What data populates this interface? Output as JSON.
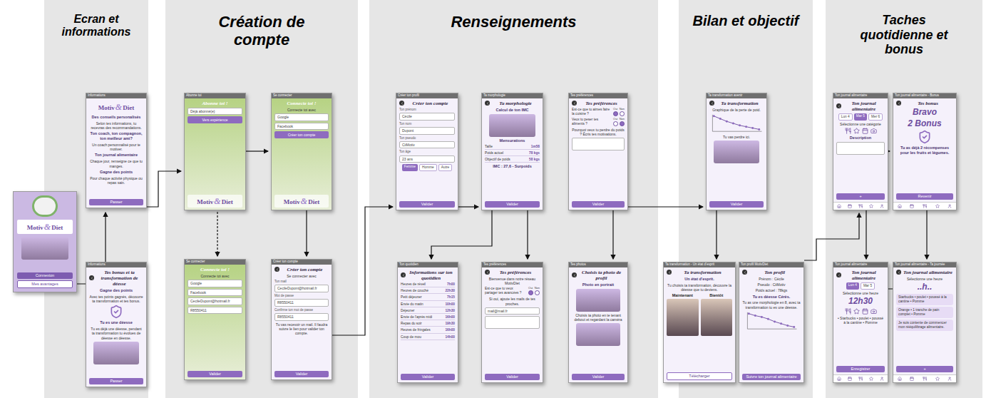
{
  "sections": [
    {
      "title": "Ecran et informations"
    },
    {
      "title": "Création de compte"
    },
    {
      "title": "Renseignements"
    },
    {
      "title": "Bilan et objectif"
    },
    {
      "title": "Taches quotidienne et bonus"
    }
  ],
  "screens": [
    {
      "kind": "splash",
      "logo": {
        "first": "Motiv",
        "amp": "&",
        "second": "Diet"
      },
      "items": [
        {
          "kind": "photo"
        }
      ],
      "buttons": [
        {
          "label": "Connexion",
          "kind": "primary"
        },
        {
          "label": "Mes avantages",
          "kind": "outline"
        }
      ]
    },
    {
      "kind": "app",
      "bar": "Informations",
      "logo": {
        "first": "Motiv",
        "amp": "&",
        "second": "Diet"
      },
      "items": [
        {
          "kind": "title",
          "text": "Des conseils personalisés"
        },
        {
          "kind": "text",
          "text": "Selon tes informations, tu recevras des recommandations."
        },
        {
          "kind": "title",
          "text": "Ton coach, ton compagnon, ton meilleur ami?"
        },
        {
          "kind": "text",
          "text": "Un coach personnalisé pour te motiver."
        },
        {
          "kind": "title",
          "text": "Ton journal alimentaire"
        },
        {
          "kind": "text",
          "text": "Chaque jour, renseigne ce que tu manges."
        },
        {
          "kind": "title",
          "text": "Gagne des points"
        },
        {
          "kind": "text",
          "text": "Pour chaque activité physique ou repas sain."
        }
      ],
      "buttons": [
        {
          "label": "Passer",
          "kind": "primary"
        }
      ]
    },
    {
      "kind": "app",
      "bar": "Informations",
      "heading": "Tes bonus et ta transformation de déesse",
      "items": [
        {
          "kind": "title",
          "text": "Gagne des points"
        },
        {
          "kind": "text",
          "text": "Avec tes points gagnés, découvre ta transformation et tes bonus."
        },
        {
          "kind": "badge"
        },
        {
          "kind": "title",
          "text": "Tu es une déesse"
        },
        {
          "kind": "text",
          "text": "Tu es déjà une déesse, pendant ta transformation tu évolues de déesse en déesse."
        },
        {
          "kind": "photo"
        }
      ],
      "buttons": [
        {
          "label": "Passer",
          "kind": "primary"
        }
      ]
    },
    {
      "kind": "photo",
      "bar": "Abonne toi",
      "heading": "Abonne toi !",
      "logo": {
        "first": "Motiv",
        "amp": "&",
        "second": "Diet"
      },
      "items": [
        {
          "kind": "field",
          "text": "Déjà abonné(e)"
        },
        {
          "kind": "button",
          "text": "Vers expérience"
        }
      ],
      "buttons": []
    },
    {
      "kind": "photo",
      "bar": "Se connecter",
      "heading": "Connecte toi !",
      "logo": {
        "first": "Motiv",
        "amp": "&",
        "second": "Diet"
      },
      "items": [
        {
          "kind": "text",
          "text": "Connecte toi avec"
        },
        {
          "kind": "field",
          "text": "Google"
        },
        {
          "kind": "field",
          "text": "Facebook"
        },
        {
          "kind": "button",
          "text": "Créer ton compte"
        }
      ],
      "buttons": []
    },
    {
      "kind": "photo",
      "bar": "Se connecter",
      "heading": "Connecte toi !",
      "items": [
        {
          "kind": "text",
          "text": "Connecte toi avec"
        },
        {
          "kind": "field",
          "text": "Google"
        },
        {
          "kind": "field",
          "text": "Facebook"
        },
        {
          "kind": "field",
          "text": "CecileDupont@hotmail.fr"
        },
        {
          "kind": "field",
          "text": "R8550411"
        }
      ],
      "buttons": [
        {
          "label": "Valider",
          "kind": "primary"
        }
      ]
    },
    {
      "kind": "app",
      "bar": "Créer ton compte",
      "heading": "Créer ton compte",
      "items": [
        {
          "kind": "text",
          "text": "Se connecter avec"
        },
        {
          "kind": "label",
          "text": "Ton mail"
        },
        {
          "kind": "field",
          "text": "CecileDupont@hotmail.fr"
        },
        {
          "kind": "label",
          "text": "Mot de passe"
        },
        {
          "kind": "field",
          "text": "R8550411"
        },
        {
          "kind": "label",
          "text": "Confirme ton mot de passe"
        },
        {
          "kind": "field",
          "text": "R8550411"
        },
        {
          "kind": "text",
          "text": "Tu vas recevoir un mail. Il faudra suivre le lien pour valider ton compte."
        }
      ],
      "buttons": [
        {
          "label": "Valider",
          "kind": "primary"
        }
      ]
    },
    {
      "kind": "app",
      "bar": "Créer ton profil",
      "heading": "Créer ton compte",
      "items": [
        {
          "kind": "label",
          "text": "Ton prénom"
        },
        {
          "kind": "field",
          "text": "Cécile"
        },
        {
          "kind": "label",
          "text": "Ton nom"
        },
        {
          "kind": "field",
          "text": "Dupont"
        },
        {
          "kind": "label",
          "text": "Ton pseudo"
        },
        {
          "kind": "field",
          "text": "CiiMotiv"
        },
        {
          "kind": "label",
          "text": "Ton âge"
        },
        {
          "kind": "field",
          "text": "23 ans"
        },
        {
          "kind": "pills",
          "options": [
            {
              "label": "Femme",
              "selected": true
            },
            {
              "label": "Homme",
              "selected": false
            },
            {
              "label": "Autre",
              "selected": false
            }
          ]
        }
      ],
      "buttons": [
        {
          "label": "Valider",
          "kind": "primary"
        }
      ]
    },
    {
      "kind": "app",
      "bar": "Ta morphologie",
      "heading": "Ta morphologie",
      "items": [
        {
          "kind": "title",
          "text": "Calcul de ton IMC"
        },
        {
          "kind": "photo"
        },
        {
          "kind": "title",
          "text": "Mensurations"
        },
        {
          "kind": "row",
          "label": "Taille",
          "value": "1m58"
        },
        {
          "kind": "row",
          "label": "Poids actuel",
          "value": "78 kgs"
        },
        {
          "kind": "row",
          "label": "Objectif de poids",
          "value": "58 kgs"
        },
        {
          "kind": "title",
          "text": "IMC : 27,6 - Surpoids"
        }
      ],
      "buttons": [
        {
          "label": "Valider",
          "kind": "primary"
        }
      ]
    },
    {
      "kind": "app",
      "bar": "Tes préférences",
      "heading": "Tes préférences",
      "items": [
        {
          "kind": "yesno",
          "text": "Est-ce que tu aimes faire la cuisine ?",
          "options": [
            {
              "label": "Oui",
              "selected": true
            },
            {
              "label": "Non",
              "selected": false
            }
          ]
        },
        {
          "kind": "yesno",
          "text": "Veux tu peser tes aliments ?",
          "options": [
            {
              "label": "Oui",
              "selected": false
            },
            {
              "label": "Non",
              "selected": true
            }
          ]
        },
        {
          "kind": "text",
          "text": "Pourquoi veux tu perdre du poids ? Écris tes motivations."
        },
        {
          "kind": "area"
        }
      ],
      "buttons": [
        {
          "label": "Valider",
          "kind": "primary"
        }
      ]
    },
    {
      "kind": "app",
      "bar": "Ton quotidien",
      "heading": "Informations sur ton quotidien",
      "items": [
        {
          "kind": "row",
          "label": "Heures de réveil",
          "value": "7h00"
        },
        {
          "kind": "row",
          "label": "Heures de couché",
          "value": "22h30"
        },
        {
          "kind": "row",
          "label": "Petit déjeuner",
          "value": "7h15"
        },
        {
          "kind": "row",
          "label": "Envie du matin",
          "value": "10h00"
        },
        {
          "kind": "row",
          "label": "Déjeuner",
          "value": "12h30"
        },
        {
          "kind": "row",
          "label": "Envie de l'après midi",
          "value": "16h00"
        },
        {
          "kind": "row",
          "label": "Repas du soir",
          "value": "19h30"
        },
        {
          "kind": "row",
          "label": "Heures de fringales",
          "value": "16h00"
        },
        {
          "kind": "row",
          "label": "Coup de mou",
          "value": "14h00"
        }
      ],
      "buttons": [
        {
          "label": "Valider",
          "kind": "primary"
        }
      ]
    },
    {
      "kind": "app",
      "bar": "Tes préférences",
      "heading": "Tes préférences",
      "items": [
        {
          "kind": "text",
          "text": "Bienvenue dans notre réseau MotivDiet"
        },
        {
          "kind": "yesno",
          "text": "Est-ce que tu veux partager tes avancées ?",
          "options": [
            {
              "label": "Oui",
              "selected": true
            },
            {
              "label": "Non",
              "selected": false
            }
          ]
        },
        {
          "kind": "text",
          "text": "Si oui, ajoute les mails de tes proches."
        },
        {
          "kind": "field",
          "text": "mail@mail.fr"
        },
        {
          "kind": "area"
        }
      ],
      "buttons": [
        {
          "label": "Valider",
          "kind": "primary"
        }
      ]
    },
    {
      "kind": "app",
      "bar": "Tes photos",
      "heading": "Choisis ta photo de profil",
      "items": [
        {
          "kind": "title",
          "text": "Photo en portrait"
        },
        {
          "kind": "photo"
        },
        {
          "kind": "text",
          "text": "Choisis ta photo en te tenant debout et regardant la caméra"
        },
        {
          "kind": "photo"
        }
      ],
      "buttons": [
        {
          "label": "Valider",
          "kind": "primary"
        }
      ]
    },
    {
      "kind": "app",
      "bar": "Ta transformation avenir",
      "heading": "Ta transformation",
      "items": [
        {
          "kind": "text",
          "text": "Graphique de la perte de poid."
        },
        {
          "kind": "chart",
          "values": [
            78,
            74,
            70,
            67,
            64,
            62,
            60,
            58
          ]
        },
        {
          "kind": "text",
          "text": "Tu vas perdre ici."
        },
        {
          "kind": "photo"
        }
      ],
      "buttons": [
        {
          "label": "Valider",
          "kind": "primary"
        }
      ]
    },
    {
      "kind": "app",
      "bar": "Ta transformation - Un état d'esprit",
      "heading": "Ta transformation",
      "items": [
        {
          "kind": "title",
          "text": "Un état d'esprit."
        },
        {
          "kind": "text",
          "text": "Tu choisis ta transformation, découvre la déesse que tu deviens."
        },
        {
          "kind": "compare",
          "labels": [
            "Maintenant",
            "Bientôt"
          ]
        }
      ],
      "buttons": [
        {
          "label": "Télécharger",
          "kind": "outline"
        }
      ]
    },
    {
      "kind": "app",
      "bar": "Ton profil MotivDiet",
      "heading": "Ton profil",
      "items": [
        {
          "kind": "text",
          "text": "Prénom : Cécile"
        },
        {
          "kind": "text",
          "text": "Pseudo : CiiMotiv"
        },
        {
          "kind": "text",
          "text": "Poids actuel : 78kgs"
        },
        {
          "kind": "title",
          "text": "Tu es déesse Cérès."
        },
        {
          "kind": "text",
          "text": "Tu as une morphologie en 8, avec ta transformation tu es une déesse."
        },
        {
          "kind": "chart",
          "values": [
            78,
            75,
            73,
            70,
            66,
            63,
            60,
            58
          ]
        }
      ],
      "buttons": [
        {
          "label": "Suivre ton journal alimentaire",
          "kind": "primary"
        }
      ]
    },
    {
      "kind": "app",
      "bar": "Ton journal alimentaire",
      "heading": "Ton journal alimentaire",
      "nav": true,
      "items": [
        {
          "kind": "chips",
          "options": [
            {
              "label": "Lun 4",
              "selected": false
            },
            {
              "label": "Mar 5",
              "selected": true
            },
            {
              "label": "Mer 6",
              "selected": false
            }
          ]
        },
        {
          "kind": "text",
          "text": "Sélectionne une catégorie"
        },
        {
          "kind": "meals"
        },
        {
          "kind": "title",
          "text": "Description"
        },
        {
          "kind": "area"
        }
      ],
      "buttons": [
        {
          "label": "+",
          "kind": "primary"
        }
      ]
    },
    {
      "kind": "app",
      "bar": "Ton journal alimentaire - Bonus",
      "heading": "Tes bonus",
      "nav": true,
      "items": [
        {
          "kind": "big",
          "text": "Bravo"
        },
        {
          "kind": "big",
          "text": "2 Bonus"
        },
        {
          "kind": "badge"
        },
        {
          "kind": "title",
          "text": "Tu as déjà 2 récompenses pour les fruits et légumes."
        }
      ],
      "buttons": [
        {
          "label": "Revenir",
          "kind": "primary"
        }
      ]
    },
    {
      "kind": "app",
      "bar": "Ton journal alimentaire",
      "heading": "Ton journal alimentaire",
      "nav": true,
      "items": [
        {
          "kind": "chips",
          "options": [
            {
              "label": "Lun 4",
              "selected": true
            },
            {
              "label": "Mar 5",
              "selected": false
            }
          ]
        },
        {
          "kind": "text",
          "text": "Sélectionne une heure"
        },
        {
          "kind": "big",
          "text": "12h30"
        },
        {
          "kind": "meals"
        },
        {
          "kind": "text",
          "text": "• Starbucks • poulet • poussé à la cantine • Pomme"
        }
      ],
      "buttons": [
        {
          "label": "Enregistrer",
          "kind": "primary"
        }
      ]
    },
    {
      "kind": "app",
      "bar": "Ton journal alimentaire - Ta journée",
      "heading": "Ton journal alimentaire",
      "nav": true,
      "items": [
        {
          "kind": "text",
          "text": "Sélectionne une heure"
        },
        {
          "kind": "big",
          "text": "..h.."
        },
        {
          "kind": "entry",
          "text": "Starbucks • poulet • poussé à la cantine • Pomme"
        },
        {
          "kind": "entry",
          "text": "Orange • 1 tranche de pain complet • Pomme"
        },
        {
          "kind": "entry",
          "text": "Je suis contente de commencer mon rééquilibrage alimentaire."
        }
      ],
      "buttons": [
        {
          "label": "+",
          "kind": "primary"
        }
      ]
    }
  ]
}
